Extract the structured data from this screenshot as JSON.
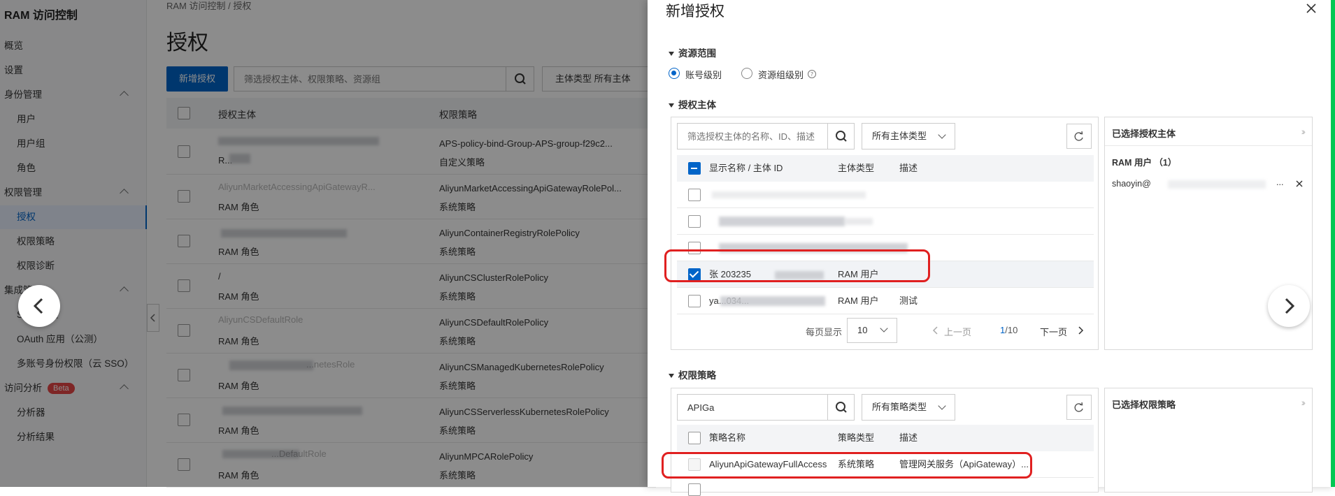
{
  "sidebar": {
    "title": "RAM 访问控制",
    "items": [
      {
        "label": "概览",
        "level": 0
      },
      {
        "label": "设置",
        "level": 0
      },
      {
        "label": "身份管理",
        "level": 0,
        "expanded": true
      },
      {
        "label": "用户",
        "level": 1
      },
      {
        "label": "用户组",
        "level": 1
      },
      {
        "label": "角色",
        "level": 1
      },
      {
        "label": "权限管理",
        "level": 0,
        "expanded": true
      },
      {
        "label": "授权",
        "level": 1,
        "active": true
      },
      {
        "label": "权限策略",
        "level": 1
      },
      {
        "label": "权限诊断",
        "level": 1
      },
      {
        "label": "集成管理",
        "level": 0,
        "expanded": true
      },
      {
        "label": "SSO 管理",
        "level": 1
      },
      {
        "label": "OAuth 应用（公测）",
        "level": 1
      },
      {
        "label": "多账号身份权限（云 SSO）",
        "level": 1
      },
      {
        "label": "访问分析",
        "level": 0,
        "expanded": true,
        "badge": "Beta"
      },
      {
        "label": "分析器",
        "level": 1
      },
      {
        "label": "分析结果",
        "level": 1
      }
    ]
  },
  "main": {
    "breadcrumb": "RAM 访问控制 / 授权",
    "title": "授权",
    "new_button": "新增授权",
    "search_placeholder": "筛选授权主体、权限策略、资源组",
    "type_select": "主体类型   所有主体",
    "columns": [
      "授权主体",
      "权限策略"
    ],
    "rows": [
      {
        "principal_type": "R...",
        "policy": "APS-policy-bind-Group-APS-group-f29c2...",
        "policy_type": "自定义策略",
        "principal_name": "..."
      },
      {
        "principal_type": "RAM 角色",
        "policy": "AliyunMarketAccessingApiGatewayRolePol...",
        "policy_type": "系统策略",
        "principal_name": "AliyunMarketAccessingApiGatewayR..."
      },
      {
        "principal_type": "RAM 角色",
        "policy": "AliyunContainerRegistryRolePolicy",
        "policy_type": "系统策略",
        "principal_name": ""
      },
      {
        "principal_type": "RAM 角色",
        "policy": "AliyunCSClusterRolePolicy",
        "policy_type": "系统策略",
        "principal_name": "/"
      },
      {
        "principal_type": "RAM 角色",
        "policy": "AliyunCSDefaultRolePolicy",
        "policy_type": "系统策略",
        "principal_name": "AliyunCSDefaultRole"
      },
      {
        "principal_type": "RAM 角色",
        "policy": "AliyunCSManagedKubernetesRolePolicy",
        "policy_type": "系统策略",
        "principal_name": "...netesRole"
      },
      {
        "principal_type": "RAM 角色",
        "policy": "AliyunCSServerlessKubernetesRolePolicy",
        "policy_type": "系统策略",
        "principal_name": ""
      },
      {
        "principal_type": "RAM 角色",
        "policy": "AliyunMPCARolePolicy",
        "policy_type": "系统策略",
        "principal_name": "...DefaultRole"
      }
    ]
  },
  "drawer": {
    "title": "新增授权",
    "close_icon": "×",
    "resource_scope": {
      "title": "资源范围",
      "options": [
        "账号级别",
        "资源组级别"
      ],
      "selected": "账号级别"
    },
    "principal": {
      "title": "授权主体",
      "search_placeholder": "筛选授权主体的名称、ID、描述",
      "type_select": "所有主体类型",
      "columns": [
        "显示名称 / 主体 ID",
        "主体类型",
        "描述"
      ],
      "rows": [
        {
          "name": "...",
          "type": "",
          "desc": "",
          "checked": false
        },
        {
          "name": "...",
          "type": "",
          "desc": "",
          "checked": false
        },
        {
          "name": "...",
          "type": "",
          "desc": "",
          "checked": false
        },
        {
          "name": "张  203235",
          "type": "RAM 用户",
          "desc": "",
          "checked": true
        },
        {
          "name": "ya...034...",
          "type": "RAM 用户",
          "desc": "测试",
          "checked": false
        }
      ],
      "pager": {
        "page_size_label": "每页显示",
        "page_size": "10",
        "prev": "上一页",
        "page": "1",
        "total": "/10",
        "next": "下一页"
      },
      "selected_panel": {
        "title": "已选择授权主体",
        "group_label": "RAM 用户 （1）",
        "item": "shaoyin@",
        "item_suffix": "..."
      }
    },
    "policy": {
      "title": "权限策略",
      "search_value": "APIGa",
      "type_select": "所有策略类型",
      "columns": [
        "策略名称",
        "策略类型",
        "描述"
      ],
      "rows": [
        {
          "name": "AliyunApiGatewayFullAccess",
          "type": "系统策略",
          "desc": "管理网关服务（ApiGateway）...",
          "checked": false
        }
      ],
      "selected_panel": {
        "title": "已选择权限策略"
      }
    }
  },
  "colors": {
    "accent": "#0064c8",
    "highlight": "#e02020",
    "green": "#00c853"
  }
}
